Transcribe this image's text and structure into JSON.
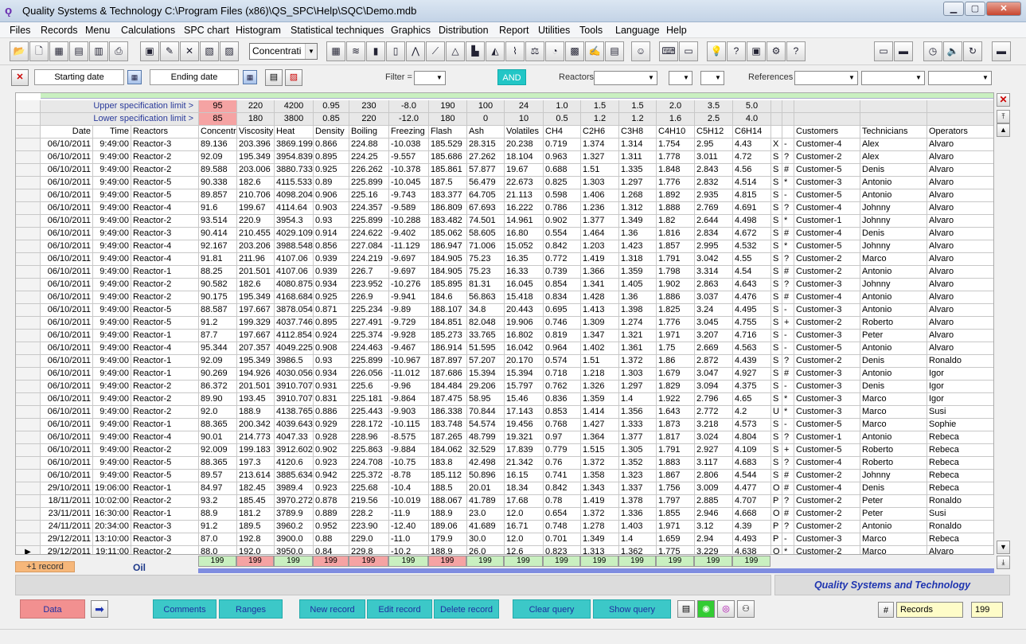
{
  "window": {
    "title": "Quality Systems & Technology   C:\\Program Files (x86)\\QS_SPC\\Help\\SQC\\Demo.mdb"
  },
  "menu": [
    "Files",
    "Records",
    "Menu",
    "Calculations",
    "SPC chart",
    "Histogram",
    "Statistical techniques",
    "Graphics",
    "Distribution",
    "Report",
    "Utilities",
    "Tools",
    "Language",
    "Help"
  ],
  "toolbar": {
    "variable_select": "Concentrati"
  },
  "filter": {
    "starting_date": "Starting date",
    "ending_date": "Ending date",
    "filter_label": "Filter =",
    "and_label": "AND",
    "reactors_label": "Reactors",
    "references_label": "References"
  },
  "grid": {
    "spec_labels": {
      "upper": "Upper specification limit >",
      "lower": "Lower specification limit >"
    },
    "upper_limits": [
      "95",
      "220",
      "4200",
      "0.95",
      "230",
      "-8.0",
      "190",
      "100",
      "24",
      "1.0",
      "1.5",
      "1.5",
      "2.0",
      "3.5",
      "5.0"
    ],
    "lower_limits": [
      "85",
      "180",
      "3800",
      "0.85",
      "220",
      "-12.0",
      "180",
      "0",
      "10",
      "0.5",
      "1.2",
      "1.2",
      "1.6",
      "2.5",
      "4.0"
    ],
    "upper_pink": [
      true,
      false,
      false,
      false,
      false,
      false,
      false,
      false,
      false,
      false,
      false,
      false,
      false,
      false,
      false
    ],
    "lower_pink": [
      true,
      false,
      false,
      false,
      false,
      false,
      false,
      false,
      false,
      false,
      false,
      false,
      false,
      false,
      false
    ],
    "headers": [
      "Date",
      "Time",
      "Reactors",
      "Concentr",
      "Viscosity",
      "Heat",
      "Density",
      "Boiling",
      "Freezing",
      "Flash",
      "Ash",
      "Volatiles",
      "CH4",
      "C2H6",
      "C3H8",
      "C4H10",
      "C5H12",
      "C6H14",
      "",
      "",
      "Customers",
      "Technicians",
      "Operators"
    ],
    "rows": [
      [
        "06/10/2011",
        "9:49:00",
        "Reactor-3",
        "89.136",
        "203.396",
        "3869.199",
        "0.866",
        "224.88",
        "-10.038",
        "185.529",
        "28.315",
        "20.238",
        "0.719",
        "1.374",
        "1.314",
        "1.754",
        "2.95",
        "4.43",
        "X",
        "-",
        "Customer-4",
        "Alex",
        "Alvaro"
      ],
      [
        "06/10/2011",
        "9:49:00",
        "Reactor-2",
        "92.09",
        "195.349",
        "3954.839",
        "0.895",
        "224.25",
        "-9.557",
        "185.686",
        "27.262",
        "18.104",
        "0.963",
        "1.327",
        "1.311",
        "1.778",
        "3.011",
        "4.72",
        "S",
        "?",
        "Customer-2",
        "Alex",
        "Alvaro"
      ],
      [
        "06/10/2011",
        "9:49:00",
        "Reactor-2",
        "89.588",
        "203.006",
        "3880.733",
        "0.925",
        "226.262",
        "-10.378",
        "185.861",
        "57.877",
        "19.67",
        "0.688",
        "1.51",
        "1.335",
        "1.848",
        "2.843",
        "4.56",
        "S",
        "#",
        "Customer-5",
        "Denis",
        "Alvaro"
      ],
      [
        "06/10/2011",
        "9:49:00",
        "Reactor-5",
        "90.338",
        "182.6",
        "4115.533",
        "0.89",
        "225.899",
        "-10.045",
        "187.5",
        "56.479",
        "22.673",
        "0.825",
        "1.303",
        "1.297",
        "1.776",
        "2.832",
        "4.514",
        "S",
        "*",
        "Customer-3",
        "Antonio",
        "Alvaro"
      ],
      [
        "06/10/2011",
        "9:49:00",
        "Reactor-5",
        "89.857",
        "210.706",
        "4098.204",
        "0.906",
        "225.16",
        "-9.743",
        "183.377",
        "64.705",
        "21.113",
        "0.598",
        "1.406",
        "1.268",
        "1.892",
        "2.935",
        "4.815",
        "S",
        "-",
        "Customer-5",
        "Antonio",
        "Alvaro"
      ],
      [
        "06/10/2011",
        "9:49:00",
        "Reactor-4",
        "91.6",
        "199.67",
        "4114.64",
        "0.903",
        "224.357",
        "-9.589",
        "186.809",
        "67.693",
        "16.222",
        "0.786",
        "1.236",
        "1.312",
        "1.888",
        "2.769",
        "4.691",
        "S",
        "?",
        "Customer-4",
        "Johnny",
        "Alvaro"
      ],
      [
        "06/10/2011",
        "9:49:00",
        "Reactor-2",
        "93.514",
        "220.9",
        "3954.3",
        "0.93",
        "225.899",
        "-10.288",
        "183.482",
        "74.501",
        "14.961",
        "0.902",
        "1.377",
        "1.349",
        "1.82",
        "2.644",
        "4.498",
        "S",
        "*",
        "Customer-1",
        "Johnny",
        "Alvaro"
      ],
      [
        "06/10/2011",
        "9:49:00",
        "Reactor-3",
        "90.414",
        "210.455",
        "4029.109",
        "0.914",
        "224.622",
        "-9.402",
        "185.062",
        "58.605",
        "16.80",
        "0.554",
        "1.464",
        "1.36",
        "1.816",
        "2.834",
        "4.672",
        "S",
        "#",
        "Customer-4",
        "Denis",
        "Alvaro"
      ],
      [
        "06/10/2011",
        "9:49:00",
        "Reactor-4",
        "92.167",
        "203.206",
        "3988.548",
        "0.856",
        "227.084",
        "-11.129",
        "186.947",
        "71.006",
        "15.052",
        "0.842",
        "1.203",
        "1.423",
        "1.857",
        "2.995",
        "4.532",
        "S",
        "*",
        "Customer-5",
        "Johnny",
        "Alvaro"
      ],
      [
        "06/10/2011",
        "9:49:00",
        "Reactor-4",
        "91.81",
        "211.96",
        "4107.06",
        "0.939",
        "224.219",
        "-9.697",
        "184.905",
        "75.23",
        "16.35",
        "0.772",
        "1.419",
        "1.318",
        "1.791",
        "3.042",
        "4.55",
        "S",
        "?",
        "Customer-2",
        "Marco",
        "Alvaro"
      ],
      [
        "06/10/2011",
        "9:49:00",
        "Reactor-1",
        "88.25",
        "201.501",
        "4107.06",
        "0.939",
        "226.7",
        "-9.697",
        "184.905",
        "75.23",
        "16.33",
        "0.739",
        "1.366",
        "1.359",
        "1.798",
        "3.314",
        "4.54",
        "S",
        "#",
        "Customer-2",
        "Antonio",
        "Alvaro"
      ],
      [
        "06/10/2011",
        "9:49:00",
        "Reactor-2",
        "90.582",
        "182.6",
        "4080.875",
        "0.934",
        "223.952",
        "-10.276",
        "185.895",
        "81.31",
        "16.045",
        "0.854",
        "1.341",
        "1.405",
        "1.902",
        "2.863",
        "4.643",
        "S",
        "?",
        "Customer-3",
        "Johnny",
        "Alvaro"
      ],
      [
        "06/10/2011",
        "9:49:00",
        "Reactor-2",
        "90.175",
        "195.349",
        "4168.684",
        "0.925",
        "226.9",
        "-9.941",
        "184.6",
        "56.863",
        "15.418",
        "0.834",
        "1.428",
        "1.36",
        "1.886",
        "3.037",
        "4.476",
        "S",
        "#",
        "Customer-4",
        "Antonio",
        "Alvaro"
      ],
      [
        "06/10/2011",
        "9:49:00",
        "Reactor-5",
        "88.587",
        "197.667",
        "3878.054",
        "0.871",
        "225.234",
        "-9.89",
        "188.107",
        "34.8",
        "20.443",
        "0.695",
        "1.413",
        "1.398",
        "1.825",
        "3.24",
        "4.495",
        "S",
        "-",
        "Customer-3",
        "Antonio",
        "Alvaro"
      ],
      [
        "06/10/2011",
        "9:49:00",
        "Reactor-5",
        "91.2",
        "199.329",
        "4037.746",
        "0.895",
        "227.491",
        "-9.729",
        "184.851",
        "82.048",
        "19.906",
        "0.746",
        "1.309",
        "1.274",
        "1.776",
        "3.045",
        "4.755",
        "S",
        "+",
        "Customer-2",
        "Roberto",
        "Alvaro"
      ],
      [
        "06/10/2011",
        "9:49:00",
        "Reactor-1",
        "87.7",
        "197.667",
        "4112.854",
        "0.924",
        "225.374",
        "-9.928",
        "185.273",
        "33.765",
        "16.802",
        "0.819",
        "1.347",
        "1.321",
        "1.971",
        "3.207",
        "4.716",
        "S",
        "-",
        "Customer-3",
        "Peter",
        "Alvaro"
      ],
      [
        "06/10/2011",
        "9:49:00",
        "Reactor-4",
        "95.344",
        "207.357",
        "4049.225",
        "0.908",
        "224.463",
        "-9.467",
        "186.914",
        "51.595",
        "16.042",
        "0.964",
        "1.402",
        "1.361",
        "1.75",
        "2.669",
        "4.563",
        "S",
        "-",
        "Customer-5",
        "Antonio",
        "Alvaro"
      ],
      [
        "06/10/2011",
        "9:49:00",
        "Reactor-1",
        "92.09",
        "195.349",
        "3986.5",
        "0.93",
        "225.899",
        "-10.967",
        "187.897",
        "57.207",
        "20.170",
        "0.574",
        "1.51",
        "1.372",
        "1.86",
        "2.872",
        "4.439",
        "S",
        "?",
        "Customer-2",
        "Denis",
        "Ronaldo"
      ],
      [
        "06/10/2011",
        "9:49:00",
        "Reactor-1",
        "90.269",
        "194.926",
        "4030.056",
        "0.934",
        "226.056",
        "-11.012",
        "187.686",
        "15.394",
        "15.394",
        "0.718",
        "1.218",
        "1.303",
        "1.679",
        "3.047",
        "4.927",
        "S",
        "#",
        "Customer-3",
        "Antonio",
        "Igor"
      ],
      [
        "06/10/2011",
        "9:49:00",
        "Reactor-2",
        "86.372",
        "201.501",
        "3910.707",
        "0.931",
        "225.6",
        "-9.96",
        "184.484",
        "29.206",
        "15.797",
        "0.762",
        "1.326",
        "1.297",
        "1.829",
        "3.094",
        "4.375",
        "S",
        "-",
        "Customer-3",
        "Denis",
        "Igor"
      ],
      [
        "06/10/2011",
        "9:49:00",
        "Reactor-2",
        "89.90",
        "193.45",
        "3910.707",
        "0.831",
        "225.181",
        "-9.864",
        "187.475",
        "58.95",
        "15.46",
        "0.836",
        "1.359",
        "1.4",
        "1.922",
        "2.796",
        "4.65",
        "S",
        "*",
        "Customer-3",
        "Marco",
        "Igor"
      ],
      [
        "06/10/2011",
        "9:49:00",
        "Reactor-2",
        "92.0",
        "188.9",
        "4138.765",
        "0.886",
        "225.443",
        "-9.903",
        "186.338",
        "70.844",
        "17.143",
        "0.853",
        "1.414",
        "1.356",
        "1.643",
        "2.772",
        "4.2",
        "U",
        "*",
        "Customer-3",
        "Marco",
        "Susi"
      ],
      [
        "06/10/2011",
        "9:49:00",
        "Reactor-1",
        "88.365",
        "200.342",
        "4039.643",
        "0.929",
        "228.172",
        "-10.115",
        "183.748",
        "54.574",
        "19.456",
        "0.768",
        "1.427",
        "1.333",
        "1.873",
        "3.218",
        "4.573",
        "S",
        "-",
        "Customer-5",
        "Marco",
        "Sophie"
      ],
      [
        "06/10/2011",
        "9:49:00",
        "Reactor-4",
        "90.01",
        "214.773",
        "4047.33",
        "0.928",
        "228.96",
        "-8.575",
        "187.265",
        "48.799",
        "19.321",
        "0.97",
        "1.364",
        "1.377",
        "1.817",
        "3.024",
        "4.804",
        "S",
        "?",
        "Customer-1",
        "Antonio",
        "Rebeca"
      ],
      [
        "06/10/2011",
        "9:49:00",
        "Reactor-2",
        "92.009",
        "199.183",
        "3912.602",
        "0.902",
        "225.863",
        "-9.884",
        "184.062",
        "32.529",
        "17.839",
        "0.779",
        "1.515",
        "1.305",
        "1.791",
        "2.927",
        "4.109",
        "S",
        "+",
        "Customer-5",
        "Roberto",
        "Rebeca"
      ],
      [
        "06/10/2011",
        "9:49:00",
        "Reactor-5",
        "88.365",
        "197.3",
        "4120.6",
        "0.923",
        "224.708",
        "-10.75",
        "183.8",
        "42.498",
        "21.342",
        "0.76",
        "1.372",
        "1.352",
        "1.883",
        "3.117",
        "4.683",
        "S",
        "?",
        "Customer-4",
        "Roberto",
        "Rebeca"
      ],
      [
        "06/10/2011",
        "9:49:00",
        "Reactor-5",
        "89.57",
        "213.614",
        "3885.634",
        "0.942",
        "225.372",
        "-8.78",
        "185.112",
        "50.896",
        "16.15",
        "0.741",
        "1.358",
        "1.323",
        "1.867",
        "2.806",
        "4.544",
        "S",
        "#",
        "Customer-2",
        "Johnny",
        "Rebeca"
      ],
      [
        "29/10/2011",
        "19:06:00",
        "Reactor-1",
        "84.97",
        "182.45",
        "3989.4",
        "0.923",
        "225.68",
        "-10.4",
        "188.5",
        "20.01",
        "18.34",
        "0.842",
        "1.343",
        "1.337",
        "1.756",
        "3.009",
        "4.477",
        "O",
        "#",
        "Customer-4",
        "Denis",
        "Rebeca"
      ],
      [
        "18/11/2011",
        "10:02:00",
        "Reactor-2",
        "93.2",
        "185.45",
        "3970.272",
        "0.878",
        "219.56",
        "-10.019",
        "188.067",
        "41.789",
        "17.68",
        "0.78",
        "1.419",
        "1.378",
        "1.797",
        "2.885",
        "4.707",
        "P",
        "?",
        "Customer-2",
        "Peter",
        "Ronaldo"
      ],
      [
        "23/11/2011",
        "16:30:00",
        "Reactor-1",
        "88.9",
        "181.2",
        "3789.9",
        "0.889",
        "228.2",
        "-11.9",
        "188.9",
        "23.0",
        "12.0",
        "0.654",
        "1.372",
        "1.336",
        "1.855",
        "2.946",
        "4.668",
        "O",
        "#",
        "Customer-2",
        "Peter",
        "Susi"
      ],
      [
        "24/11/2011",
        "20:34:00",
        "Reactor-3",
        "91.2",
        "189.5",
        "3960.2",
        "0.952",
        "223.90",
        "-12.40",
        "189.06",
        "41.689",
        "16.71",
        "0.748",
        "1.278",
        "1.403",
        "1.971",
        "3.12",
        "4.39",
        "P",
        "?",
        "Customer-2",
        "Antonio",
        "Ronaldo"
      ],
      [
        "29/12/2011",
        "13:10:00",
        "Reactor-3",
        "87.0",
        "192.8",
        "3900.0",
        "0.88",
        "229.0",
        "-11.0",
        "179.9",
        "30.0",
        "12.0",
        "0.701",
        "1.349",
        "1.4",
        "1.659",
        "2.94",
        "4.493",
        "P",
        "-",
        "Customer-3",
        "Marco",
        "Rebeca"
      ],
      [
        "29/12/2011",
        "19:11:00",
        "Reactor-2",
        "88.0",
        "192.0",
        "3950.0",
        "0.84",
        "229.8",
        "-10.2",
        "188.9",
        "26.0",
        "12.6",
        "0.823",
        "1.313",
        "1.362",
        "1.775",
        "3.229",
        "4.638",
        "O",
        "*",
        "Customer-2",
        "Marco",
        "Alvaro"
      ]
    ],
    "current_row_marker": "▶"
  },
  "summary": {
    "add_record": "+1 record",
    "table_name": "Oil",
    "counts": [
      "199",
      "199",
      "199",
      "199",
      "199",
      "199",
      "199",
      "199",
      "199",
      "199",
      "199",
      "199",
      "199",
      "199",
      "199"
    ],
    "count_pink": [
      false,
      true,
      false,
      true,
      true,
      false,
      true,
      false,
      false,
      false,
      false,
      false,
      false,
      false,
      false
    ]
  },
  "brand": "Quality Systems and Technology",
  "bottom": {
    "data": "Data",
    "comments": "Comments",
    "ranges": "Ranges",
    "new_record": "New record",
    "edit_record": "Edit record",
    "delete_record": "Delete record",
    "clear_query": "Clear query",
    "show_query": "Show query",
    "records_label": "Records",
    "records_count": "199",
    "hash": "#"
  },
  "colors": {
    "pink": "#f5a3a3",
    "green": "#c9f0c0",
    "teal": "#3cc8c8",
    "brand_blue": "#1f35b0"
  }
}
